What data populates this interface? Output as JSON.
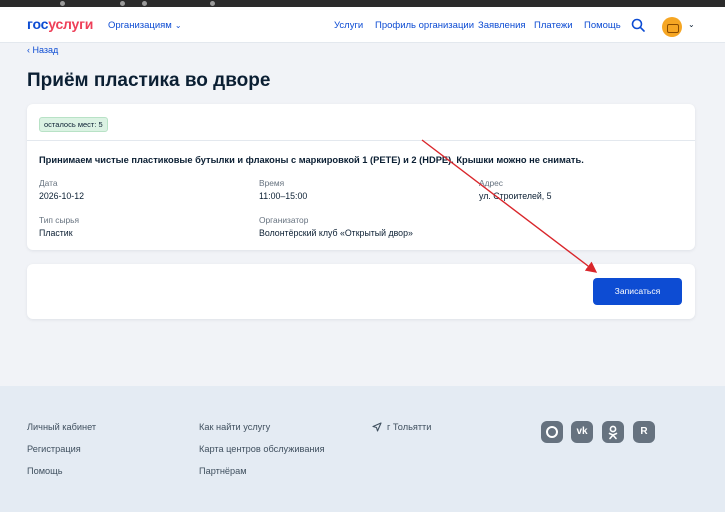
{
  "header": {
    "logo_part1": "гос",
    "logo_part2": "услуги",
    "org_menu": "Организациям",
    "nav": [
      "Услуги",
      "Профиль организации",
      "Заявления",
      "Платежи",
      "Помощь"
    ]
  },
  "back_link": "Назад",
  "page_title": "Приём пластика во дворе",
  "event": {
    "seats_badge": "осталось мест: 5",
    "description": "Принимаем чистые пластиковые бутылки и флаконы с маркировкой 1 (PETE) и 2 (HDPE). Крышки можно не снимать.",
    "date_label": "Дата",
    "date_value": "2026-10-12",
    "time_label": "Время",
    "time_value": "11:00–15:00",
    "address_label": "Адрес",
    "address_value": "ул. Строителей, 5",
    "material_label": "Тип сырья",
    "material_value": "Пластик",
    "organizer_label": "Организатор",
    "organizer_value": "Волонтёрский клуб «Открытый двор»"
  },
  "signup_button": "Записаться",
  "footer": {
    "col1": [
      "Личный кабинет",
      "Регистрация",
      "Помощь"
    ],
    "col2": [
      "Как найти услугу",
      "Карта центров обслуживания",
      "Партнёрам"
    ],
    "location": "г Тольятти",
    "social_icons": [
      "max-icon",
      "vk-icon",
      "ok-icon",
      "rustore-icon"
    ]
  },
  "colors": {
    "brand_blue": "#0d4cd3",
    "brand_red": "#ee3f58",
    "annotation_arrow": "#d9262b",
    "badge_green": "#dbf2e3"
  }
}
